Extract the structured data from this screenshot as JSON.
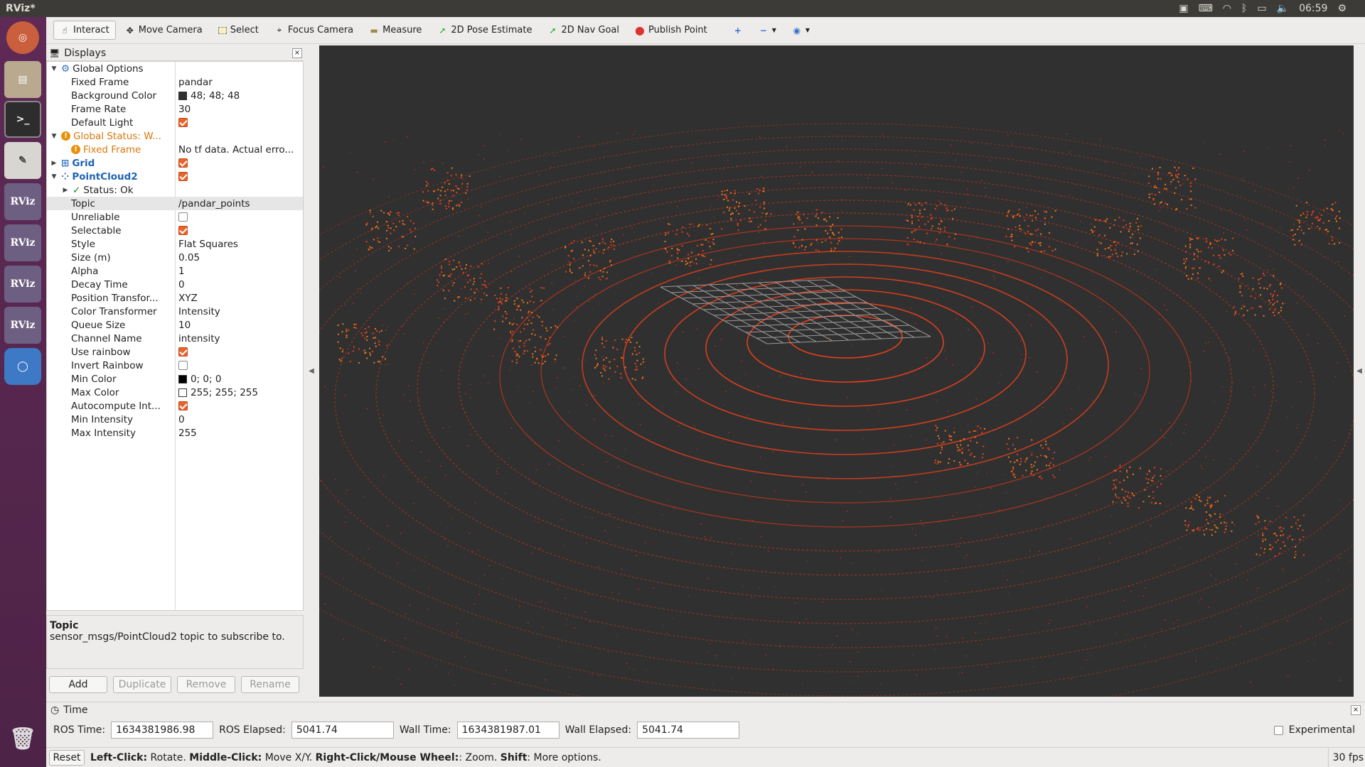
{
  "window": {
    "title": "RViz*"
  },
  "system_tray": {
    "clock": "06:59"
  },
  "launcher": {
    "items": [
      {
        "name": "ubuntu-dash",
        "label": ""
      },
      {
        "name": "files",
        "label": ""
      },
      {
        "name": "terminal",
        "label": ""
      },
      {
        "name": "text-editor",
        "label": ""
      },
      {
        "name": "rviz-1",
        "label": "RViz"
      },
      {
        "name": "rviz-2",
        "label": "RViz"
      },
      {
        "name": "rviz-3",
        "label": "RViz"
      },
      {
        "name": "rviz-4",
        "label": "RViz"
      },
      {
        "name": "chromium",
        "label": ""
      },
      {
        "name": "trash",
        "label": ""
      }
    ]
  },
  "toolbar": {
    "interact": "Interact",
    "move_camera": "Move Camera",
    "select": "Select",
    "focus_camera": "Focus Camera",
    "measure": "Measure",
    "pose_estimate": "2D Pose Estimate",
    "nav_goal": "2D Nav Goal",
    "publish_point": "Publish Point"
  },
  "displays": {
    "title": "Displays",
    "rows": [
      {
        "indent": 0,
        "arrow": "▼",
        "icon": "gear",
        "name": "Global Options",
        "value": ""
      },
      {
        "indent": 1,
        "name": "Fixed Frame",
        "value": "pandar"
      },
      {
        "indent": 1,
        "name": "Background Color",
        "value": "48; 48; 48",
        "swatch": "#303030"
      },
      {
        "indent": 1,
        "name": "Frame Rate",
        "value": "30"
      },
      {
        "indent": 1,
        "name": "Default Light",
        "check": true
      },
      {
        "indent": 0,
        "arrow": "▼",
        "icon": "warn",
        "name": "Global Status: W...",
        "value": "",
        "cls": "warn"
      },
      {
        "indent": 1,
        "icon": "warn",
        "name": "Fixed Frame",
        "value": "No tf data.  Actual erro...",
        "cls": "warn"
      },
      {
        "indent": 0,
        "arrow": "▶",
        "icon": "grid",
        "name": "Grid",
        "check": true,
        "cls": "blue"
      },
      {
        "indent": 0,
        "arrow": "▼",
        "icon": "cloud",
        "name": "PointCloud2",
        "check": true,
        "cls": "blue"
      },
      {
        "indent": 1,
        "arrow": "▶",
        "icon": "ok",
        "name": "Status: Ok",
        "value": ""
      },
      {
        "indent": 1,
        "name": "Topic",
        "value": "/pandar_points",
        "sel": true
      },
      {
        "indent": 1,
        "name": "Unreliable",
        "check": false
      },
      {
        "indent": 1,
        "name": "Selectable",
        "check": true
      },
      {
        "indent": 1,
        "name": "Style",
        "value": "Flat Squares"
      },
      {
        "indent": 1,
        "name": "Size (m)",
        "value": "0.05"
      },
      {
        "indent": 1,
        "name": "Alpha",
        "value": "1"
      },
      {
        "indent": 1,
        "name": "Decay Time",
        "value": "0"
      },
      {
        "indent": 1,
        "name": "Position Transfor...",
        "value": "XYZ"
      },
      {
        "indent": 1,
        "name": "Color Transformer",
        "value": "Intensity"
      },
      {
        "indent": 1,
        "name": "Queue Size",
        "value": "10"
      },
      {
        "indent": 1,
        "name": "Channel Name",
        "value": "intensity"
      },
      {
        "indent": 1,
        "name": "Use rainbow",
        "check": true
      },
      {
        "indent": 1,
        "name": "Invert Rainbow",
        "check": false
      },
      {
        "indent": 1,
        "name": "Min Color",
        "value": "0; 0; 0",
        "swatch": "#000000"
      },
      {
        "indent": 1,
        "name": "Max Color",
        "value": "255; 255; 255",
        "swatch": "#ffffff"
      },
      {
        "indent": 1,
        "name": "Autocompute Int...",
        "check": true
      },
      {
        "indent": 1,
        "name": "Min Intensity",
        "value": "0"
      },
      {
        "indent": 1,
        "name": "Max Intensity",
        "value": "255"
      }
    ],
    "description_title": "Topic",
    "description_text": "sensor_msgs/PointCloud2 topic to subscribe to.",
    "buttons": {
      "add": "Add",
      "duplicate": "Duplicate",
      "remove": "Remove",
      "rename": "Rename"
    }
  },
  "time_panel": {
    "title": "Time",
    "ros_time_label": "ROS Time:",
    "ros_time": "1634381986.98",
    "ros_elapsed_label": "ROS Elapsed:",
    "ros_elapsed": "5041.74",
    "wall_time_label": "Wall Time:",
    "wall_time": "1634381987.01",
    "wall_elapsed_label": "Wall Elapsed:",
    "wall_elapsed": "5041.74",
    "experimental": "Experimental"
  },
  "statusbar": {
    "reset": "Reset",
    "h1": "Left-Click:",
    "t1": " Rotate. ",
    "h2": "Middle-Click:",
    "t2": " Move X/Y. ",
    "h3": "Right-Click/Mouse Wheel:",
    "t3": ": Zoom. ",
    "h4": "Shift",
    "t4": ": More options.",
    "fps": "30 fps"
  },
  "colors": {
    "viewport_bg": "#303030",
    "point_red": "#e8401c",
    "point_orange": "#ee7a1a",
    "accent_check": "#e9632c"
  }
}
